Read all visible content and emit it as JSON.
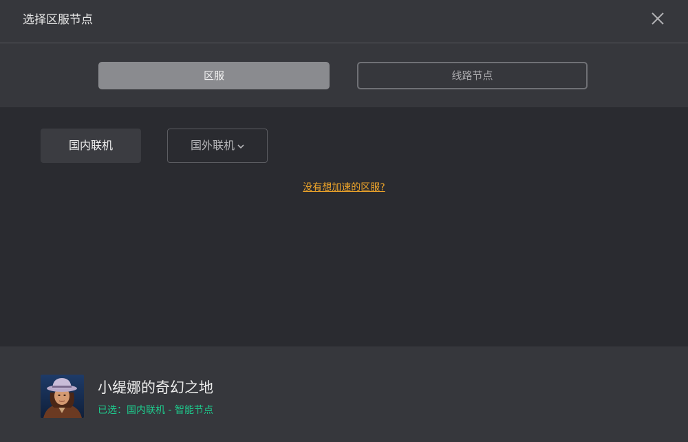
{
  "window": {
    "title": "选择区服节点",
    "close_icon": "close-icon"
  },
  "tabs": [
    {
      "label": "区服",
      "active": true
    },
    {
      "label": "线路节点",
      "active": false
    }
  ],
  "regions": {
    "domestic_label": "国内联机",
    "overseas_label": "国外联机",
    "overseas_icon": "chevron-down-icon"
  },
  "help_link": "没有想加速的区服?",
  "game": {
    "title": "小缇娜的奇幻之地",
    "selected_status": "已选：国内联机 - 智能节点"
  },
  "colors": {
    "accent_link": "#f0a62a",
    "status_green": "#1ec98c",
    "active_tab": "#8a8b8f"
  }
}
